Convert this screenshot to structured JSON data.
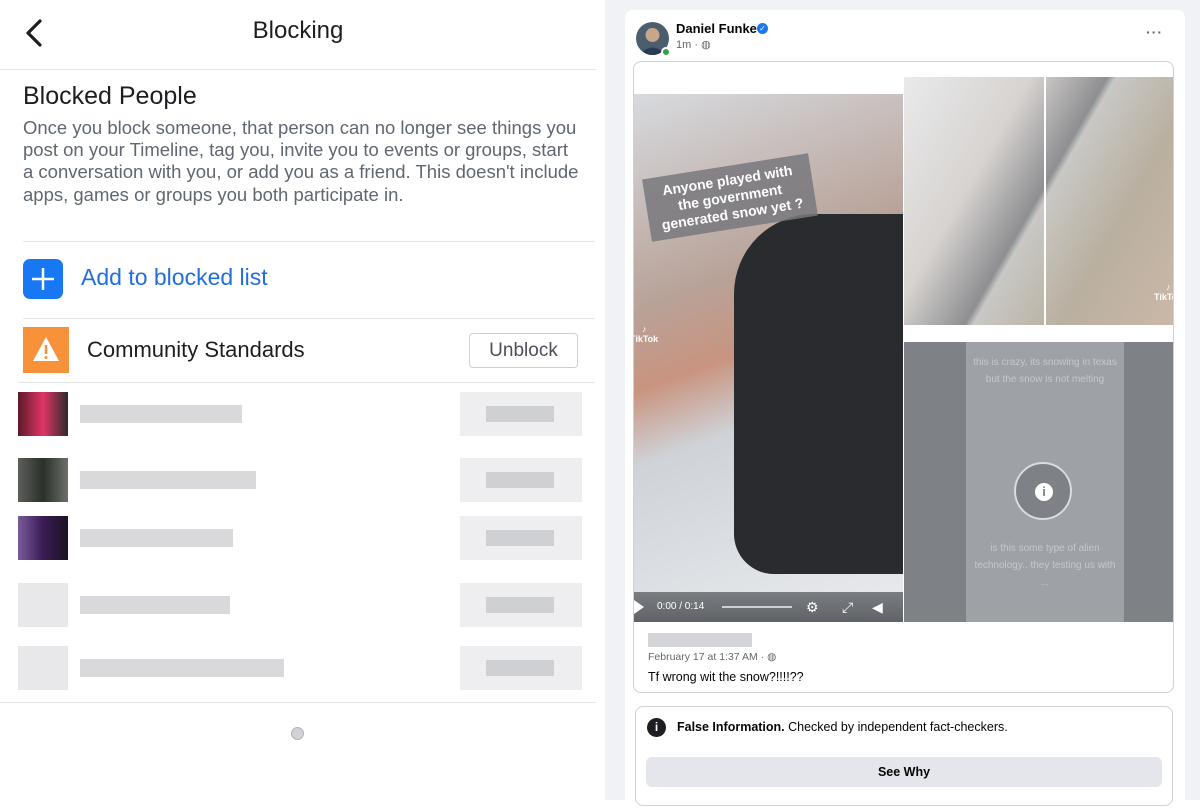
{
  "blocking": {
    "title": "Blocking",
    "section_title": "Blocked People",
    "description": "Once you block someone, that person can no longer see things you post on your Timeline, tag you, invite you to events or groups, start a conversation with you, or add you as a friend. This doesn't include apps, games or groups you both participate in.",
    "add_label": "Add to blocked list",
    "community_label": "Community Standards",
    "unblock_label": "Unblock",
    "blurred_rows": 5
  },
  "post": {
    "author": "Daniel Funke",
    "time": "1m · ",
    "more": "···",
    "video_caption": "Anyone played with the government generated snow yet ?",
    "tiktok": "TikTok",
    "video_time": "0:00 / 0:14",
    "overlay_caption_top": "this is crazy, its snowing in texas but the snow is not melting",
    "overlay_caption_bottom": "is this some type of alien technology.. they testing us with ...",
    "shared_date": "February 17 at 1:37 AM · ",
    "shared_text": "Tf wrong wit the snow?!!!!??",
    "fact_check_title": "False Information.",
    "fact_check_text": " Checked by independent fact-checkers.",
    "see_why": "See Why"
  },
  "colors": {
    "accent": "#1877f2",
    "warning": "#f7923a"
  },
  "icons": {
    "back": "chevron-left-icon",
    "add": "plus-icon",
    "warning": "warning-icon",
    "info": "info-icon",
    "globe": "globe-icon",
    "verified": "verified-badge-icon"
  }
}
